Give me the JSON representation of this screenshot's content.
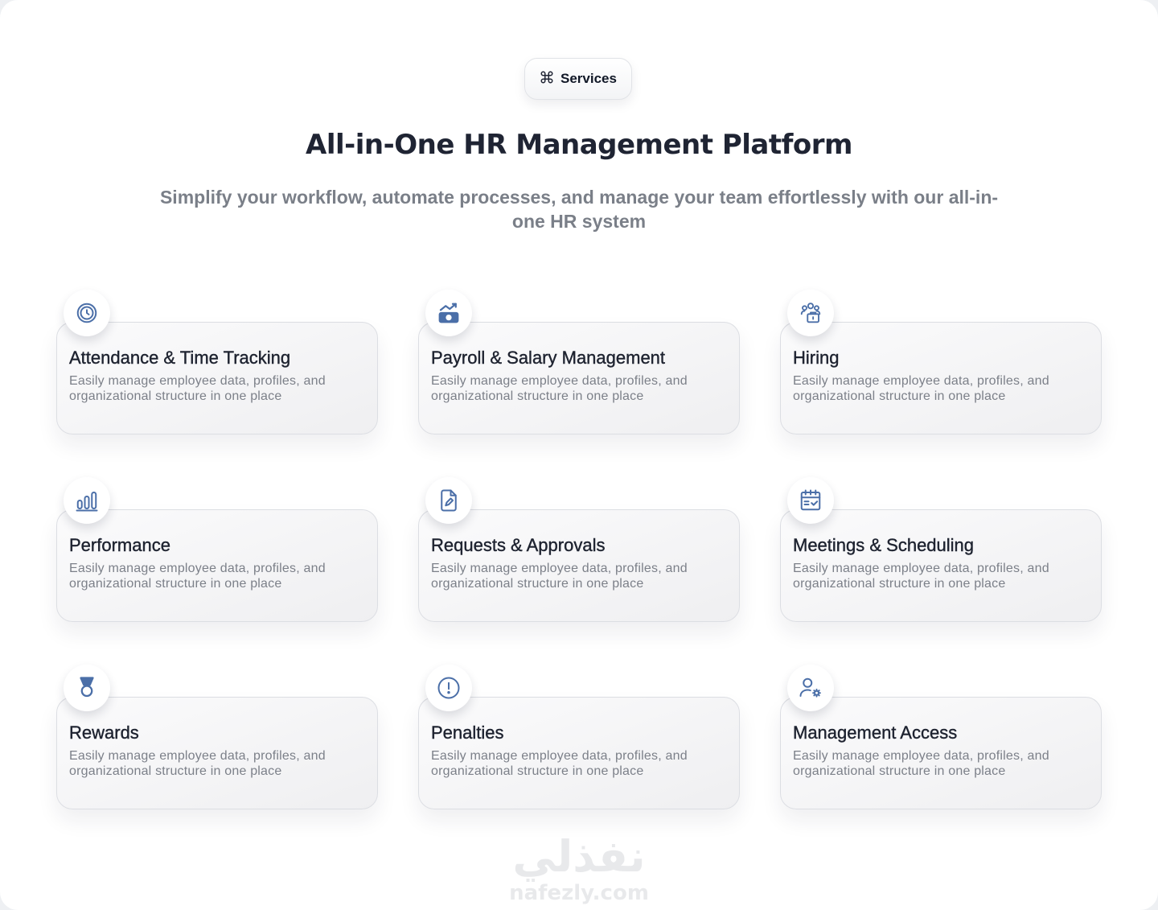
{
  "badge": {
    "label": "Services",
    "icon": "command-icon"
  },
  "header": {
    "title": "All-in-One HR Management Platform",
    "subtitle": "Simplify your workflow, automate processes, and manage your team effortlessly with our all-in-one HR system"
  },
  "colors": {
    "accent_icon": "#4b6fa8",
    "title_text": "#1f2433",
    "muted_text": "#7a7f88"
  },
  "services": [
    {
      "title": "Attendance & Time Tracking",
      "description": "Easily manage employee data, profiles, and organizational structure in one place",
      "icon": "clock-icon"
    },
    {
      "title": "Payroll & Salary Management",
      "description": "Easily manage employee data, profiles, and organizational structure in one place",
      "icon": "payroll-chart-icon"
    },
    {
      "title": "Hiring",
      "description": "Easily manage employee data, profiles, and organizational structure in one place",
      "icon": "hiring-people-icon"
    },
    {
      "title": "Performance",
      "description": "Easily manage employee data, profiles, and organizational structure in one place",
      "icon": "bar-chart-icon"
    },
    {
      "title": "Requests & Approvals",
      "description": "Easily manage employee data, profiles, and organizational structure in one place",
      "icon": "document-edit-icon"
    },
    {
      "title": "Meetings & Scheduling",
      "description": "Easily manage employee data, profiles, and organizational structure in one place",
      "icon": "calendar-check-icon"
    },
    {
      "title": "Rewards",
      "description": "Easily manage employee data, profiles, and organizational structure in one place",
      "icon": "medal-icon"
    },
    {
      "title": "Penalties",
      "description": "Easily manage employee data, profiles, and organizational structure in one place",
      "icon": "alert-circle-icon"
    },
    {
      "title": "Management Access",
      "description": "Easily manage employee data, profiles, and organizational structure in one place",
      "icon": "user-settings-icon"
    }
  ],
  "watermark": {
    "arabic": "نفذلي",
    "latin": "nafezly.com"
  }
}
